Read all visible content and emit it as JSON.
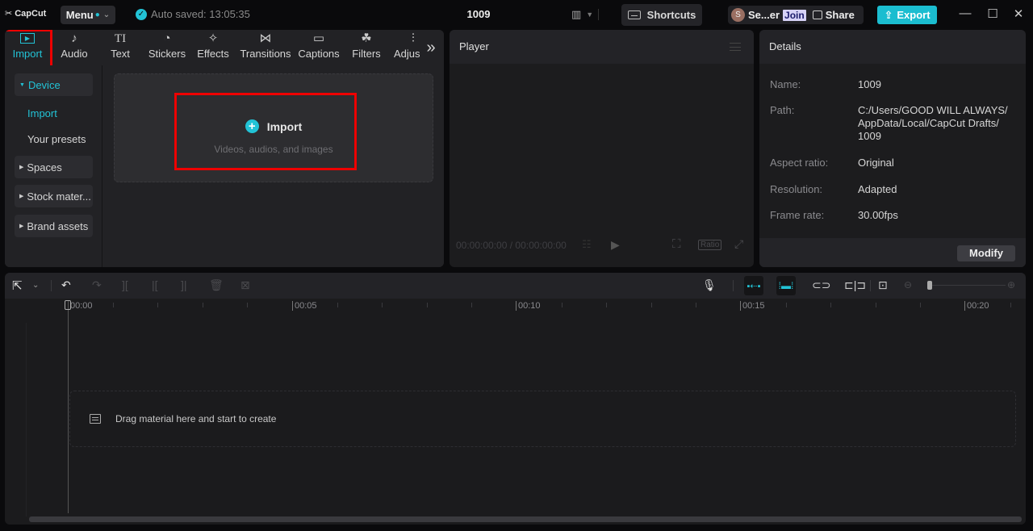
{
  "app": {
    "logo": "CapCut",
    "menu_label": "Menu",
    "autosave": "Auto saved: 13:05:35",
    "project_title": "1009",
    "shortcuts_label": "Shortcuts",
    "user_short": "Se...er",
    "avatar_letter": "S",
    "join_label": "Join",
    "share_label": "Share",
    "export_label": "Export",
    "accent": "#22c3d6"
  },
  "media": {
    "tabs": [
      {
        "label": "Import",
        "icon": "import-icon",
        "glyph": "▶"
      },
      {
        "label": "Audio",
        "icon": "audio-icon",
        "glyph": "♪"
      },
      {
        "label": "Text",
        "icon": "text-icon",
        "glyph": "TI"
      },
      {
        "label": "Stickers",
        "icon": "stickers-icon",
        "glyph": "◔"
      },
      {
        "label": "Effects",
        "icon": "effects-icon",
        "glyph": "✧"
      },
      {
        "label": "Transitions",
        "icon": "transitions-icon",
        "glyph": "⋈"
      },
      {
        "label": "Captions",
        "icon": "captions-icon",
        "glyph": "▭"
      },
      {
        "label": "Filters",
        "icon": "filters-icon",
        "glyph": "☘"
      },
      {
        "label": "Adjus",
        "icon": "adjust-icon",
        "glyph": "⫶"
      }
    ],
    "more_glyph": "»",
    "sidebar": {
      "device": "Device",
      "import": "Import",
      "presets": "Your presets",
      "spaces": "Spaces",
      "stock": "Stock mater...",
      "brand": "Brand assets"
    },
    "dropzone": {
      "title": "Import",
      "subtitle": "Videos, audios, and images"
    }
  },
  "player": {
    "title": "Player",
    "timecode": "00:00:00:00 / 00:00:00:00",
    "ratio_label": "Ratio"
  },
  "details": {
    "title": "Details",
    "rows": [
      {
        "label": "Name:",
        "value": "1009"
      },
      {
        "label": "Path:",
        "value": "C:/Users/GOOD WILL ALWAYS/ AppData/Local/CapCut Drafts/ 1009"
      },
      {
        "label": "Aspect ratio:",
        "value": "Original"
      },
      {
        "label": "Resolution:",
        "value": "Adapted"
      },
      {
        "label": "Frame rate:",
        "value": "30.00fps"
      }
    ],
    "modify_label": "Modify"
  },
  "timeline": {
    "ticks": [
      "00:00",
      "00:05",
      "00:10",
      "00:15",
      "00:20"
    ],
    "drop_text": "Drag material here and start to create"
  }
}
